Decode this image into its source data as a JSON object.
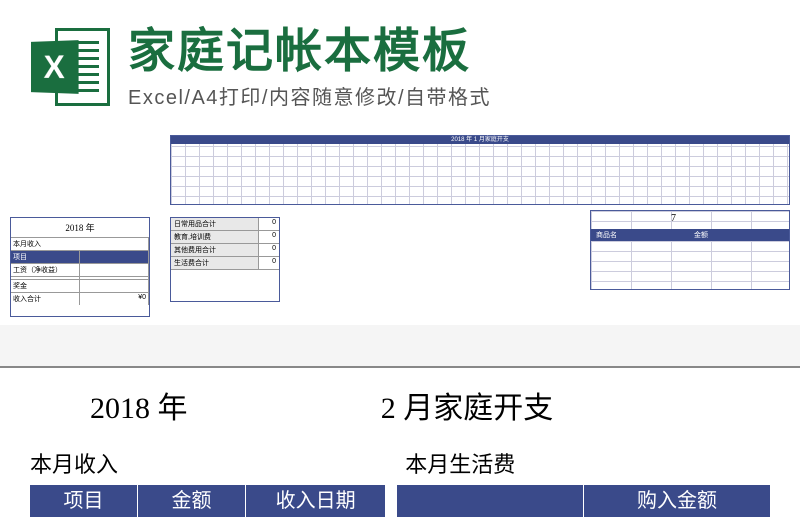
{
  "header": {
    "icon_letter": "X",
    "title": "家庭记帐本模板",
    "subtitle": "Excel/A4打印/内容随意修改/自带格式"
  },
  "mini_wide": {
    "header": "2018 年   1 月家庭开支"
  },
  "mini_left": {
    "title": "2018 年",
    "section": "本月收入",
    "col1": "项目",
    "col2": "",
    "row1": "工资（净收益）",
    "row_total": "收入合计",
    "row_bonus": "奖金",
    "total_val": "¥0"
  },
  "mini_summary": {
    "rows": [
      {
        "label": "日常用品合计",
        "val": "0"
      },
      {
        "label": "教育,培训费",
        "val": "0"
      },
      {
        "label": "其他费用合计",
        "val": "0"
      },
      {
        "label": "生活费合计",
        "val": "0"
      }
    ]
  },
  "mini_right": {
    "number": "7",
    "col1": "商品名",
    "col2": "金额"
  },
  "big": {
    "year": "2018 年",
    "month_title": "2 月家庭开支",
    "left_section": "本月收入",
    "right_section": "本月生活费",
    "left_cols": [
      "项目",
      "金额",
      "收入日期"
    ],
    "right_cols": [
      "",
      "购入金额"
    ]
  }
}
